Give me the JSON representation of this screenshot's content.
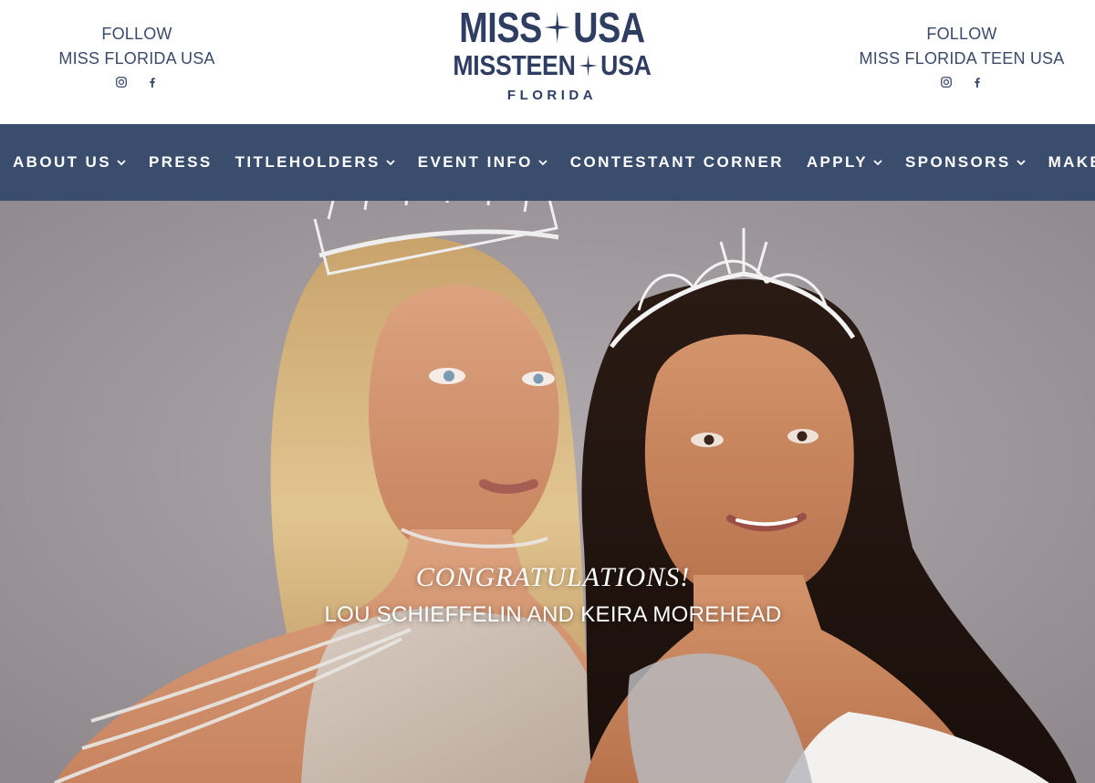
{
  "header": {
    "left_follow": {
      "line1": "FOLLOW",
      "line2": "MISS FLORIDA USA",
      "icons": [
        "instagram-icon",
        "facebook-icon"
      ]
    },
    "right_follow": {
      "line1": "FOLLOW",
      "line2": "MISS FLORIDA TEEN USA",
      "icons": [
        "instagram-icon",
        "facebook-icon"
      ]
    },
    "logo": {
      "row1_left": "MISS",
      "row1_right": "USA",
      "row2_left": "MISSTEEN",
      "row2_right": "USA",
      "subtitle": "FLORIDA"
    }
  },
  "nav": {
    "items": [
      {
        "label": "ABOUT US",
        "has_dropdown": true
      },
      {
        "label": "PRESS",
        "has_dropdown": false
      },
      {
        "label": "TITLEHOLDERS",
        "has_dropdown": true
      },
      {
        "label": "EVENT INFO",
        "has_dropdown": true
      },
      {
        "label": "CONTESTANT CORNER",
        "has_dropdown": false
      },
      {
        "label": "APPLY",
        "has_dropdown": true
      },
      {
        "label": "SPONSORS",
        "has_dropdown": true
      },
      {
        "label": "MAKE A P",
        "has_dropdown": false
      }
    ]
  },
  "hero": {
    "title": "CONGRATULATIONS!",
    "names": "LOU SCHIEFFELIN AND KEIRA MOREHEAD",
    "image_description": "two-titleholders-with-crowns"
  },
  "colors": {
    "brand_navy": "#2f3d63",
    "nav_bg": "#3b4d6d",
    "header_text": "#3b4a6b",
    "hero_bg": "#a09a9e"
  }
}
